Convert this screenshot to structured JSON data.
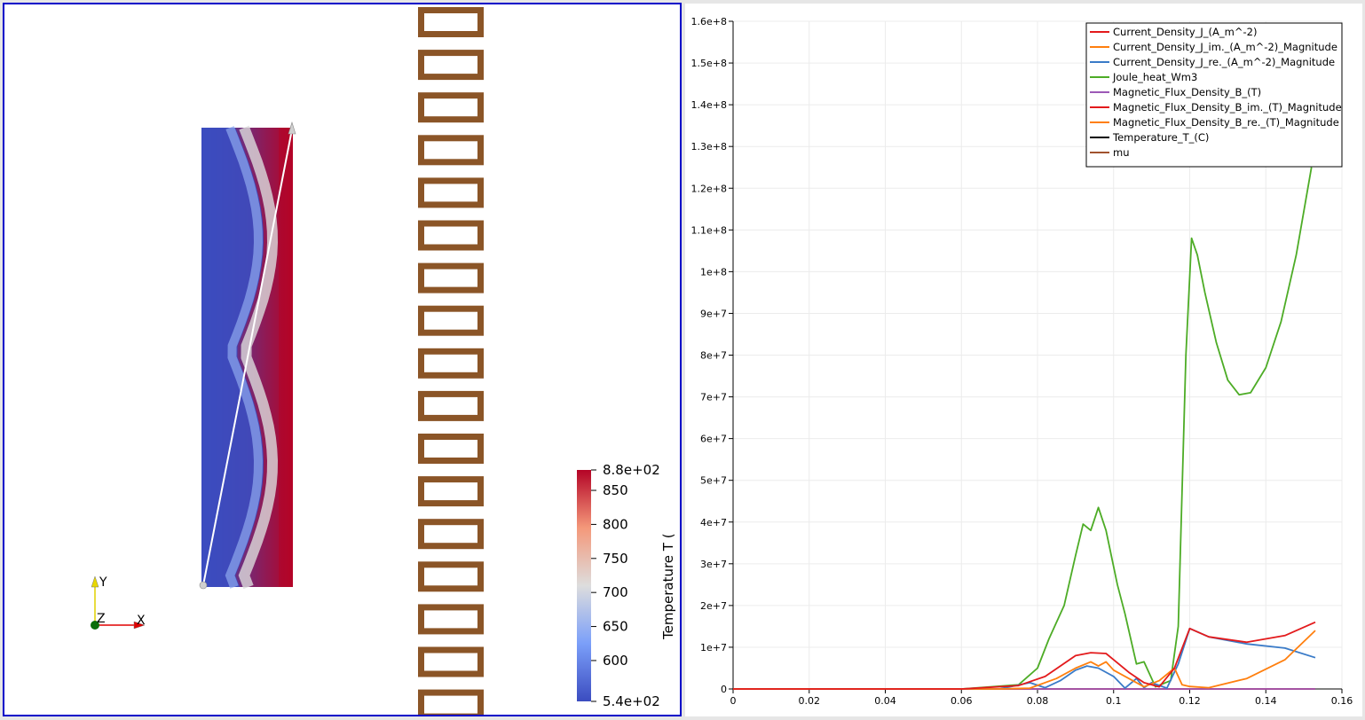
{
  "render_view": {
    "color_legend": {
      "title": "Temperature T (",
      "max_label": "8.8e+02",
      "min_label": "5.4e+02",
      "ticks": [
        "850",
        "800",
        "750",
        "700",
        "650",
        "600"
      ],
      "range": [
        540,
        880
      ]
    },
    "axes_triad": {
      "y": "Y",
      "z": "Z",
      "x": "X"
    },
    "coil_turn_count": 17,
    "colors": {
      "coil": "#8b5527",
      "cold": "#3b4cc0",
      "hot": "#b40426",
      "frame": "#0000c8",
      "line_probe": "#ffffff"
    }
  },
  "chart_data": {
    "type": "line",
    "xlim": [
      0,
      0.16
    ],
    "ylim": [
      0,
      160000000
    ],
    "x_ticks": [
      "0",
      "0.02",
      "0.04",
      "0.06",
      "0.08",
      "0.1",
      "0.12",
      "0.14",
      "0.16"
    ],
    "y_ticks": [
      "0",
      "1e+7",
      "2e+7",
      "3e+7",
      "4e+7",
      "5e+7",
      "6e+7",
      "7e+7",
      "8e+7",
      "9e+7",
      "1e+8",
      "1.1e+8",
      "1.2e+8",
      "1.3e+8",
      "1.4e+8",
      "1.5e+8",
      "1.6e+8"
    ],
    "grid": true,
    "legend_position": "top-right",
    "series": [
      {
        "name": "Current_Density_J_(A_m^-2)",
        "color": "#e31a1c",
        "x": [
          0,
          0.06,
          0.075,
          0.082,
          0.09,
          0.094,
          0.098,
          0.1,
          0.104,
          0.108,
          0.112,
          0.116,
          0.12,
          0.125,
          0.135,
          0.145,
          0.153
        ],
        "y": [
          0,
          0,
          800000,
          3000000,
          8000000,
          8700000,
          8500000,
          7000000,
          4000000,
          1500000,
          500000,
          5000000,
          14500000,
          12500000,
          11200000,
          12800000,
          16000000
        ]
      },
      {
        "name": "Current_Density_J_im._(A_m^-2)_Magnitude",
        "color": "#ff7f0e",
        "x": [
          0,
          0.07,
          0.078,
          0.085,
          0.09,
          0.094,
          0.096,
          0.098,
          0.1,
          0.104,
          0.108,
          0.112,
          0.116,
          0.118,
          0.12,
          0.125,
          0.135,
          0.145,
          0.153
        ],
        "y": [
          0,
          0,
          200000,
          2500000,
          5000000,
          6500000,
          5500000,
          6500000,
          4500000,
          2500000,
          500000,
          2000000,
          5000000,
          1000000,
          600000,
          300000,
          2500000,
          7000000,
          14000000
        ]
      },
      {
        "name": "Current_Density_J_re._(A_m^-2)_Magnitude",
        "color": "#3a7bc8",
        "x": [
          0,
          0.07,
          0.078,
          0.082,
          0.086,
          0.09,
          0.093,
          0.096,
          0.1,
          0.103,
          0.106,
          0.108,
          0.11,
          0.114,
          0.117,
          0.12,
          0.125,
          0.135,
          0.145,
          0.153
        ],
        "y": [
          0,
          0,
          1500000,
          300000,
          2000000,
          4500000,
          5500000,
          5000000,
          3000000,
          200000,
          2500000,
          300000,
          1500000,
          200000,
          6000000,
          14500000,
          12500000,
          10800000,
          9800000,
          7500000
        ]
      },
      {
        "name": "Joule_heat_Wm3",
        "color": "#4dac26",
        "x": [
          0,
          0.06,
          0.075,
          0.08,
          0.083,
          0.087,
          0.09,
          0.092,
          0.094,
          0.096,
          0.098,
          0.101,
          0.103,
          0.106,
          0.108,
          0.111,
          0.115,
          0.117,
          0.119,
          0.1205,
          0.122,
          0.124,
          0.127,
          0.13,
          0.133,
          0.136,
          0.14,
          0.144,
          0.148,
          0.152
        ],
        "y": [
          0,
          0,
          1000000,
          5000000,
          12000000,
          20000000,
          32000000,
          39500000,
          38000000,
          43500000,
          38000000,
          25000000,
          18000000,
          6000000,
          6500000,
          500000,
          2000000,
          15000000,
          80000000,
          108000000,
          104000000,
          95000000,
          83000000,
          74000000,
          70500000,
          71000000,
          77000000,
          88000000,
          104000000,
          125000000
        ]
      },
      {
        "name": "Magnetic_Flux_Density_B_(T)",
        "color": "#9c59b6",
        "x": [
          0,
          0.153
        ],
        "y": [
          0,
          0
        ]
      },
      {
        "name": "Magnetic_Flux_Density_B_im._(T)_Magnitude",
        "color": "#e31a1c",
        "x": [
          0,
          0.153
        ],
        "y": [
          0,
          0
        ]
      },
      {
        "name": "Magnetic_Flux_Density_B_re._(T)_Magnitude",
        "color": "#ff7f0e",
        "x": [
          0,
          0.153
        ],
        "y": [
          0,
          0
        ]
      },
      {
        "name": "Temperature_T_(C)",
        "color": "#000000",
        "x": [
          0,
          0.153
        ],
        "y": [
          0,
          0
        ]
      },
      {
        "name": "mu",
        "color": "#a0522d",
        "x": [
          0,
          0.153
        ],
        "y": [
          0,
          0
        ]
      }
    ]
  }
}
